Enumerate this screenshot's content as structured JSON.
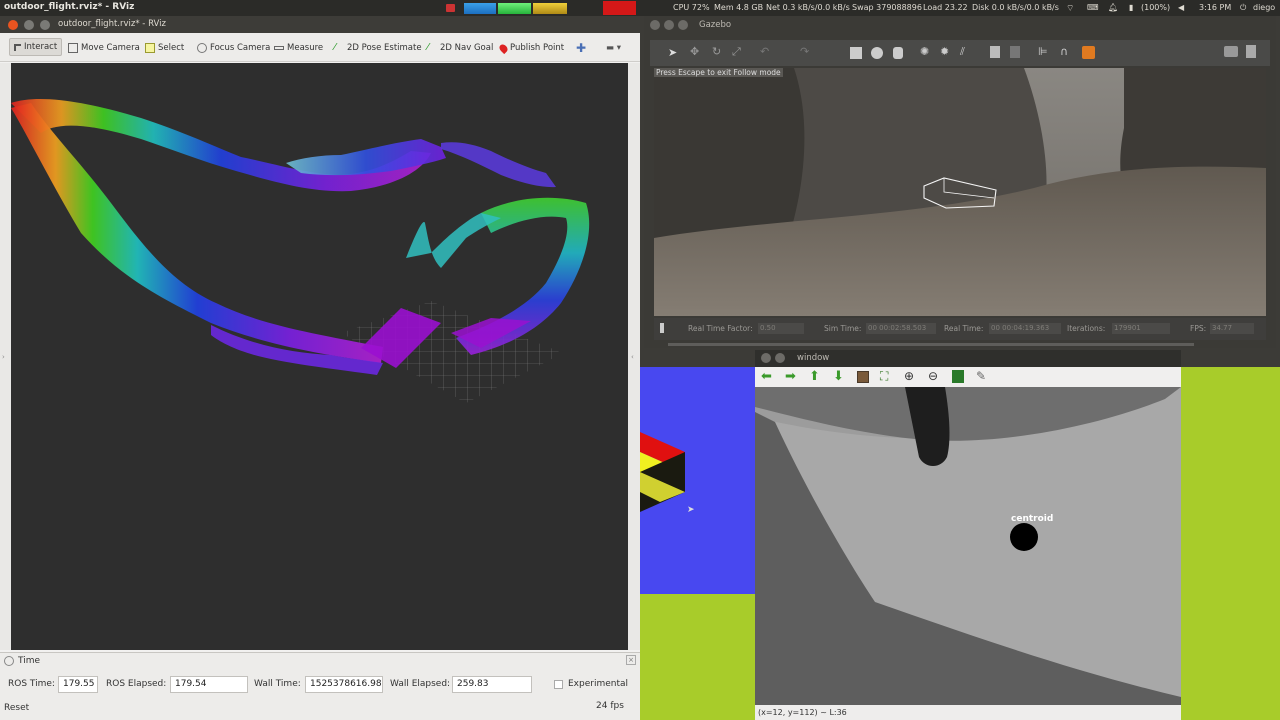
{
  "top_panel": {
    "window_title": "outdoor_flight.rviz* - RViz",
    "cpu": "CPU 72%",
    "mem": "Mem 4.8 GB",
    "net": "Net 0.3 kB/s/0.0 kB/s",
    "swap": "Swap 379088896",
    "load": "Load 23.22",
    "disk": "Disk 0.0 kB/s/0.0 kB/s",
    "battery": "(100%)",
    "clock": "3:16 PM",
    "user": "diego"
  },
  "rviz": {
    "title": "outdoor_flight.rviz* - RViz",
    "tools": [
      "Interact",
      "Move Camera",
      "Select",
      "Focus Camera",
      "Measure",
      "2D Pose Estimate",
      "2D Nav Goal",
      "Publish Point"
    ],
    "time_panel": {
      "title": "Time",
      "ros_time_label": "ROS Time:",
      "ros_time": "179.55",
      "ros_elapsed_label": "ROS Elapsed:",
      "ros_elapsed": "179.54",
      "wall_time_label": "Wall Time:",
      "wall_time": "1525378616.98",
      "wall_elapsed_label": "Wall Elapsed:",
      "wall_elapsed": "259.83",
      "experimental_label": "Experimental",
      "reset_label": "Reset",
      "fps": "24 fps"
    }
  },
  "gazebo": {
    "title": "Gazebo",
    "follow_hint": "Press Escape to exit Follow mode",
    "real_time_factor_label": "Real Time Factor:",
    "real_time_factor": "0.50",
    "sim_time_label": "Sim Time:",
    "sim_time": "00 00:02:58.503",
    "real_time_label": "Real Time:",
    "real_time": "00 00:04:19.363",
    "iterations_label": "Iterations:",
    "iterations": "179901",
    "fps_label": "FPS:",
    "fps": "34.77"
  },
  "cv_window": {
    "title": "window",
    "centroid_label": "centroid",
    "status": "(x=12, y=112) ~ L:36"
  },
  "colors": {
    "panel_bg": "#2b2b28",
    "rviz_bg": "#2e2e2e",
    "desktop_blue": "#4848f0",
    "desktop_green": "#a8cc2a"
  }
}
